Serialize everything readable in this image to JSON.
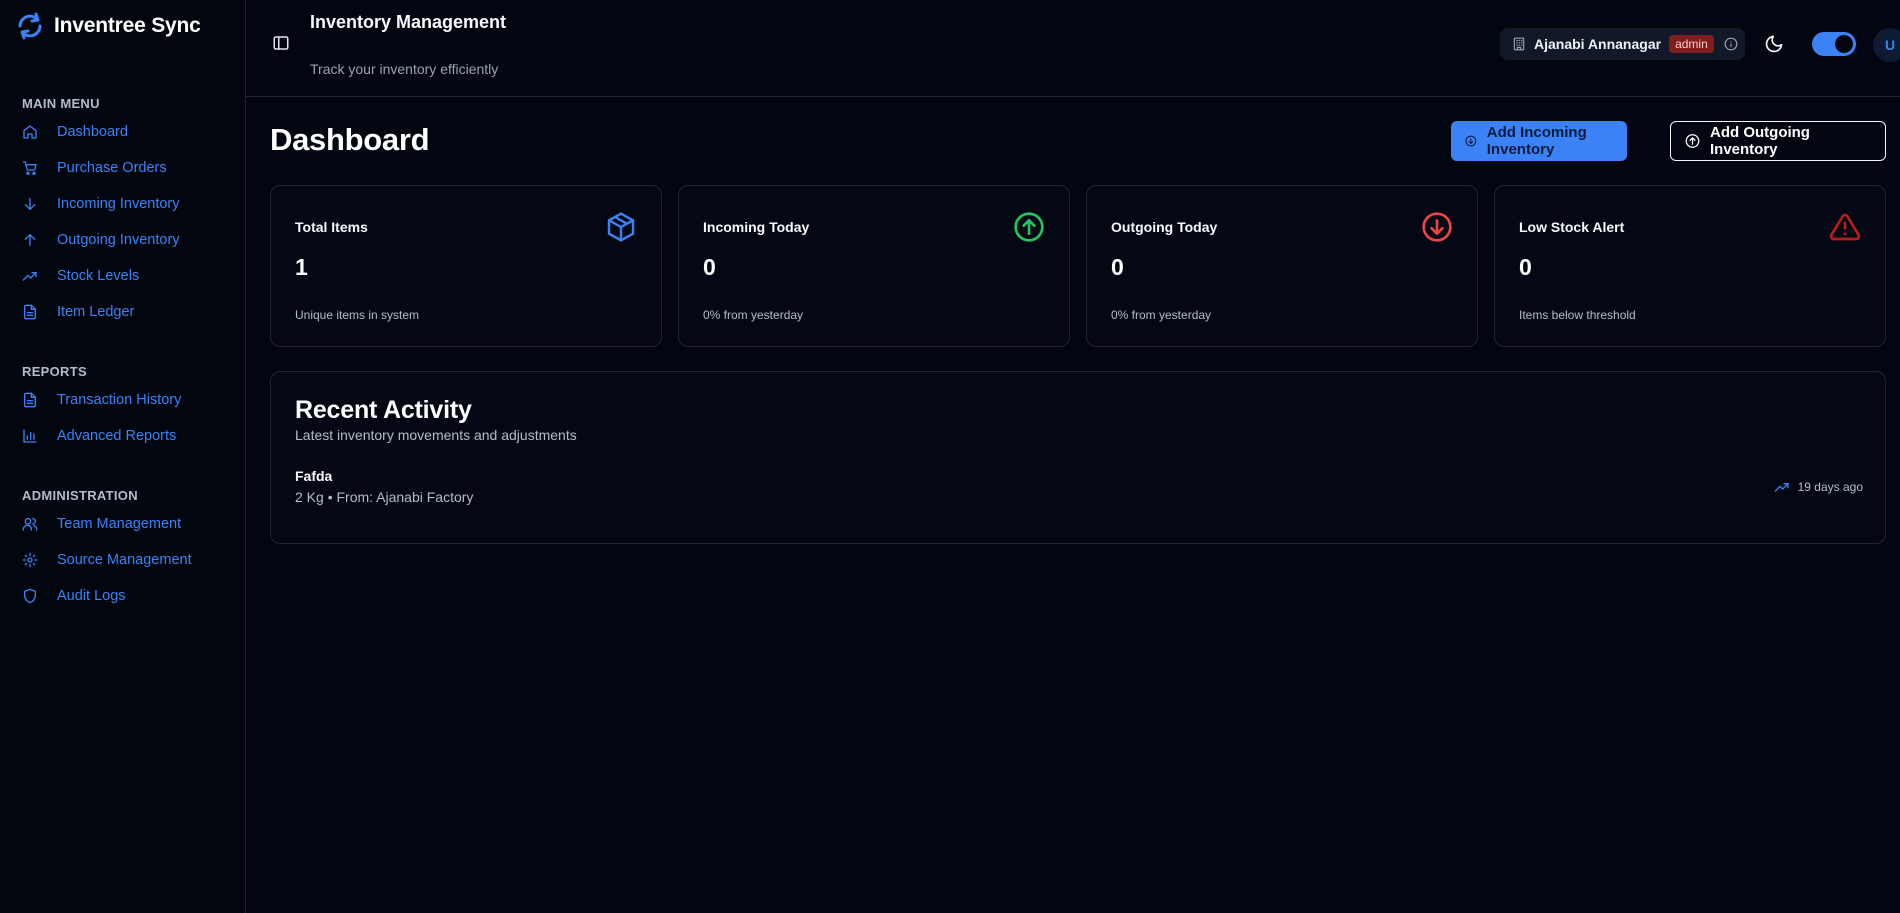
{
  "brand": {
    "name": "Inventree Sync"
  },
  "sidebar": {
    "sections": [
      {
        "heading": "MAIN MENU",
        "items": [
          {
            "label": "Dashboard",
            "icon": "home-icon"
          },
          {
            "label": "Purchase Orders",
            "icon": "cart-icon"
          },
          {
            "label": "Incoming Inventory",
            "icon": "arrow-down-icon"
          },
          {
            "label": "Outgoing Inventory",
            "icon": "arrow-up-icon"
          },
          {
            "label": "Stock Levels",
            "icon": "trending-up-icon"
          },
          {
            "label": "Item Ledger",
            "icon": "file-icon"
          }
        ]
      },
      {
        "heading": "REPORTS",
        "items": [
          {
            "label": "Transaction History",
            "icon": "file-icon"
          },
          {
            "label": "Advanced Reports",
            "icon": "bar-chart-icon"
          }
        ]
      },
      {
        "heading": "ADMINISTRATION",
        "items": [
          {
            "label": "Team Management",
            "icon": "users-icon"
          },
          {
            "label": "Source Management",
            "icon": "gear-icon"
          },
          {
            "label": "Audit Logs",
            "icon": "shield-icon"
          }
        ]
      }
    ]
  },
  "header": {
    "title": "Inventory Management",
    "subtitle": "Track your inventory efficiently",
    "store_name": "Ajanabi Annanagar",
    "role": "admin",
    "avatar_initial": "U"
  },
  "dashboard": {
    "title": "Dashboard",
    "add_incoming_label": "Add Incoming Inventory",
    "add_outgoing_label": "Add Outgoing Inventory"
  },
  "stats": [
    {
      "title": "Total Items",
      "value": "1",
      "foot": "Unique items in system",
      "icon": "package-icon",
      "color": "#3b82f6"
    },
    {
      "title": "Incoming Today",
      "value": "0",
      "foot": "0% from yesterday",
      "icon": "arrow-up-circle-icon",
      "color": "#22c55e"
    },
    {
      "title": "Outgoing Today",
      "value": "0",
      "foot": "0% from yesterday",
      "icon": "arrow-down-circle-icon",
      "color": "#ef4444"
    },
    {
      "title": "Low Stock Alert",
      "value": "0",
      "foot": "Items below threshold",
      "icon": "warning-icon",
      "color": "#b91c1c"
    }
  ],
  "activity": {
    "title": "Recent Activity",
    "subtitle": "Latest inventory movements and adjustments",
    "rows": [
      {
        "name": "Fafda",
        "detail": "2 Kg • From: Ajanabi Factory",
        "time": "19 days ago"
      }
    ]
  },
  "colors": {
    "accent": "#3b82f6",
    "background": "#020611",
    "success": "#22c55e",
    "danger": "#ef4444"
  }
}
